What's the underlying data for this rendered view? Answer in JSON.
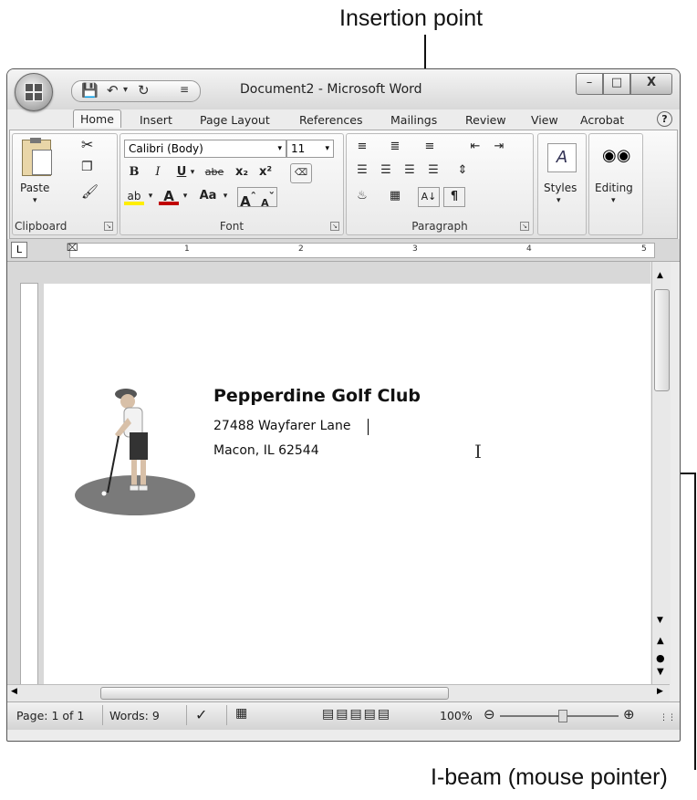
{
  "annotations": {
    "insertion_point": "Insertion point",
    "ibeam": "I-beam (mouse pointer)"
  },
  "window": {
    "title": "Document2 - Microsoft Word",
    "minimize": "–",
    "maximize": "□",
    "close": "X"
  },
  "quick_access": {
    "save_icon": "floppy-disk",
    "undo_icon": "undo-arrow",
    "redo_icon": "redo-arrow",
    "customize_icon": "dropdown"
  },
  "tabs": [
    "Home",
    "Insert",
    "Page Layout",
    "References",
    "Mailings",
    "Review",
    "View",
    "Acrobat"
  ],
  "active_tab": "Home",
  "ribbon": {
    "clipboard": {
      "label": "Clipboard",
      "paste": "Paste"
    },
    "font": {
      "label": "Font",
      "font_name": "Calibri (Body)",
      "font_size": "11",
      "bold": "B",
      "italic": "I",
      "underline": "U",
      "strike": "abe",
      "subscript": "x₂",
      "superscript": "x²",
      "change_case": "Aa",
      "grow": "A",
      "shrink": "A"
    },
    "paragraph": {
      "label": "Paragraph",
      "show_marks": "¶"
    },
    "styles": {
      "label": "Styles"
    },
    "editing": {
      "label": "Editing"
    }
  },
  "ruler": {
    "numbers": [
      "1",
      "2",
      "3",
      "4",
      "5"
    ],
    "tab_selector": "L"
  },
  "document": {
    "company": "Pepperdine Golf Club",
    "address1": "27488 Wayfarer Lane",
    "address2": "Macon, IL 62544"
  },
  "status": {
    "page": "Page: 1 of 1",
    "words": "Words: 9",
    "zoom": "100%"
  },
  "colors": {
    "ellipse": "#7a7a7a",
    "window_border": "#555555"
  }
}
